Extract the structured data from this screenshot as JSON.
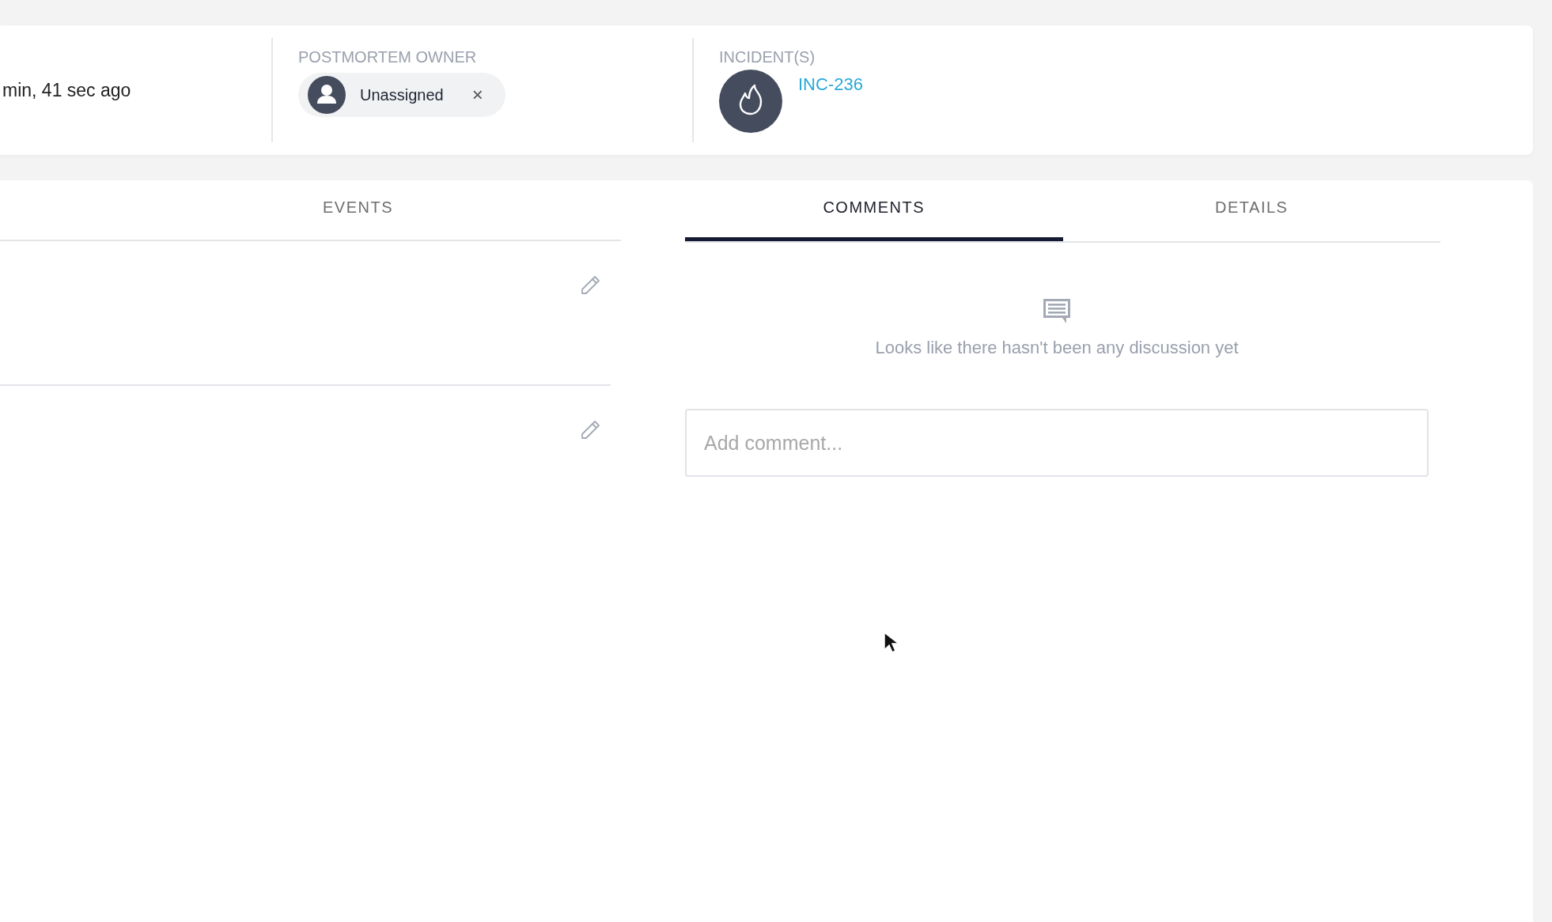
{
  "header": {
    "time_ago": "min, 41 sec ago",
    "owner": {
      "label": "POSTMORTEM OWNER",
      "name": "Unassigned",
      "remove": "×"
    },
    "incidents": {
      "label": "INCIDENT(S)",
      "items": [
        {
          "id": "INC-236"
        }
      ]
    }
  },
  "events_panel": {
    "tab": {
      "label": "EVENTS",
      "selected": false
    },
    "rows": [
      {
        "kind": "editable"
      },
      {
        "kind": "editable"
      }
    ]
  },
  "tabs": [
    {
      "label": "COMMENTS",
      "selected": true
    },
    {
      "label": "DETAILS",
      "selected": false
    }
  ],
  "comments": {
    "empty_message": "Looks like there hasn't been any discussion yet",
    "input": {
      "placeholder": "Add comment..."
    }
  }
}
